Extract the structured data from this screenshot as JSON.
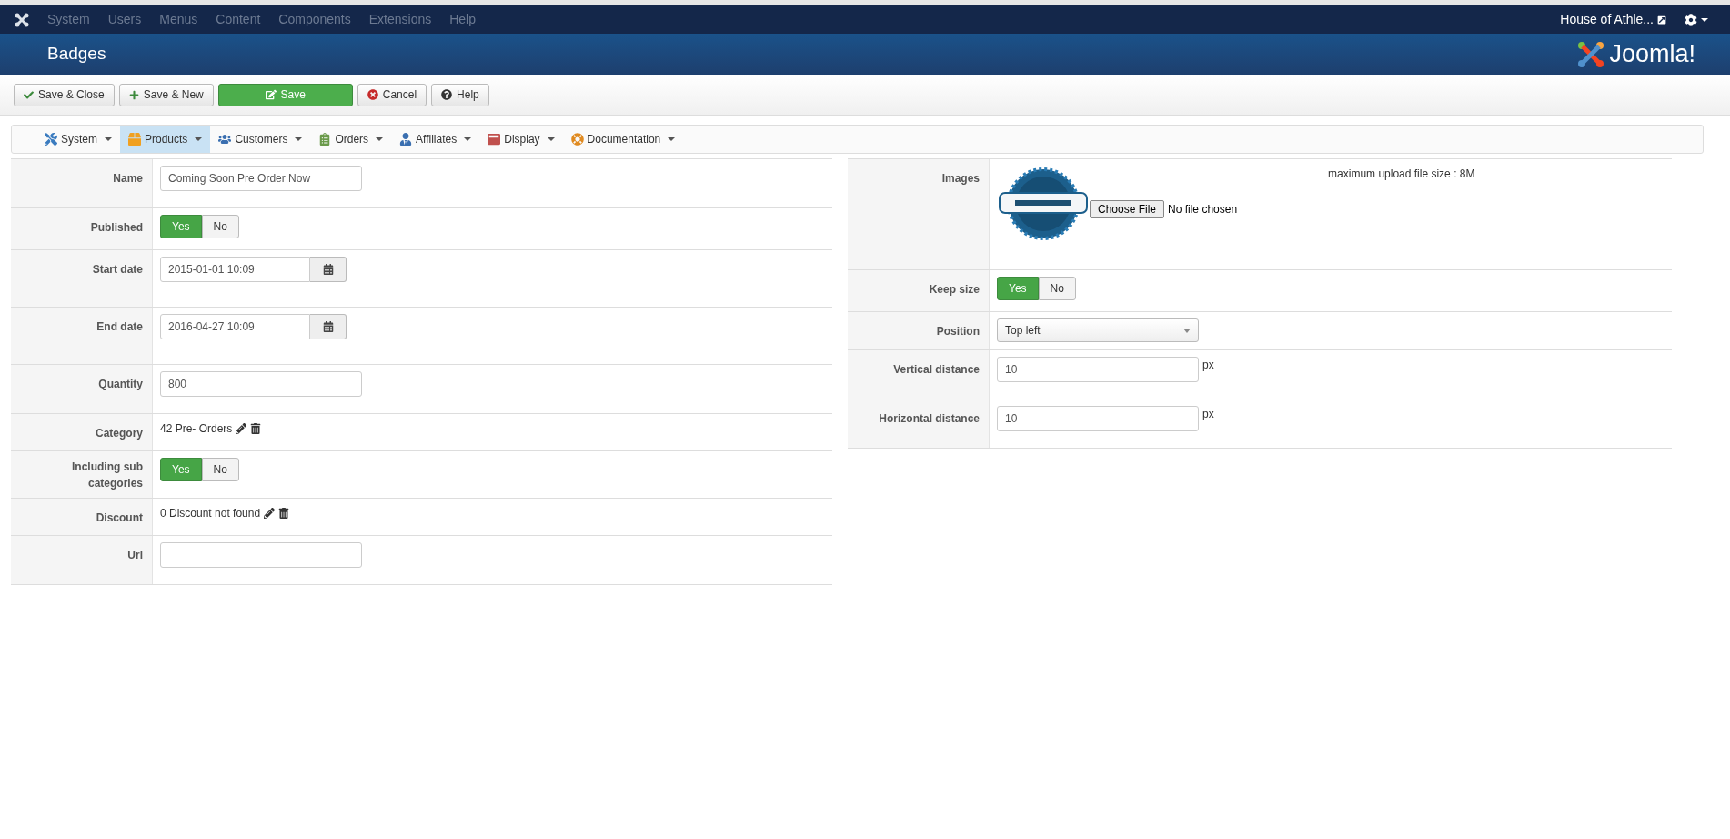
{
  "top_menu": {
    "items": [
      "System",
      "Users",
      "Menus",
      "Content",
      "Components",
      "Extensions",
      "Help"
    ],
    "site_link": "House of Athle..."
  },
  "header": {
    "title": "Badges",
    "logo_text": "Joomla!"
  },
  "toolbar": [
    {
      "kind": "check",
      "label": "Save & Close"
    },
    {
      "kind": "plus",
      "label": "Save & New"
    },
    {
      "kind": "save",
      "label": "Save"
    },
    {
      "kind": "cancel",
      "label": "Cancel"
    },
    {
      "kind": "help",
      "label": "Help"
    }
  ],
  "submenu": [
    {
      "kind": "tools",
      "label": "System",
      "selected": false
    },
    {
      "kind": "box",
      "label": "Products",
      "selected": true
    },
    {
      "kind": "people",
      "label": "Customers",
      "selected": false
    },
    {
      "kind": "list",
      "label": "Orders",
      "selected": false
    },
    {
      "kind": "person",
      "label": "Affiliates",
      "selected": false
    },
    {
      "kind": "window",
      "label": "Display",
      "selected": false
    },
    {
      "kind": "help",
      "label": "Documentation",
      "selected": false
    }
  ],
  "left_form": [
    {
      "kind": "text",
      "label": "Name",
      "value": "Coming Soon Pre Order Now"
    },
    {
      "kind": "toggle",
      "label": "Published",
      "options": [
        {
          "label": "Yes",
          "selected": true
        },
        {
          "label": "No",
          "selected": false
        }
      ]
    },
    {
      "kind": "date",
      "label": "Start date",
      "value": "2015-01-01 10:09"
    },
    {
      "kind": "date",
      "label": "End date",
      "value": "2016-04-27 10:09"
    },
    {
      "kind": "text",
      "label": "Quantity",
      "value": "800"
    },
    {
      "kind": "link",
      "label": "Category",
      "value": "42 Pre- Orders"
    },
    {
      "kind": "toggle",
      "label": "Including sub categories",
      "options": [
        {
          "label": "Yes",
          "selected": true
        },
        {
          "label": "No",
          "selected": false
        }
      ]
    },
    {
      "kind": "link",
      "label": "Discount",
      "value": "0 Discount not found"
    },
    {
      "kind": "text",
      "label": "Url"
    }
  ],
  "right_form": [
    {
      "kind": "image",
      "label": "Images",
      "note": "maximum upload file size : 8M",
      "button": "Choose File",
      "status": "No file chosen"
    },
    {
      "kind": "toggle",
      "label": "Keep size",
      "options": [
        {
          "label": "Yes",
          "selected": true
        },
        {
          "label": "No",
          "selected": false
        }
      ]
    },
    {
      "kind": "select",
      "label": "Position",
      "value": "Top left"
    },
    {
      "kind": "unit",
      "label": "Vertical distance",
      "value": "10",
      "unit": "px"
    },
    {
      "kind": "unit",
      "label": "Horizontal distance",
      "value": "10",
      "unit": "px"
    }
  ]
}
